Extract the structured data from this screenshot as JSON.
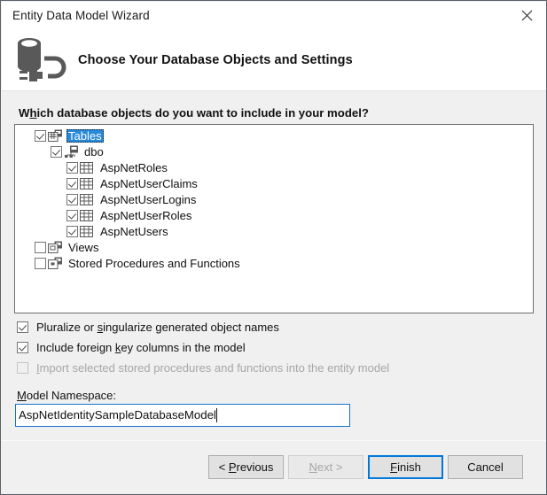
{
  "window": {
    "title": "Entity Data Model Wizard",
    "close_icon": "close-icon"
  },
  "header": {
    "icon": "database-connection-icon",
    "title": "Choose Your Database Objects and Settings"
  },
  "main": {
    "prompt_label_pre": "W",
    "prompt_label_accel": "h",
    "prompt_label_post": "ich database objects do you want to include in your model?",
    "prompt_label_full": "Which database objects do you want to include in your model?"
  },
  "tree": {
    "nodes": [
      {
        "label": "Tables",
        "level": 0,
        "checked": true,
        "selected": true,
        "icon": "tables-folder-icon"
      },
      {
        "label": "dbo",
        "level": 1,
        "checked": true,
        "selected": false,
        "icon": "schema-icon"
      },
      {
        "label": "AspNetRoles",
        "level": 2,
        "checked": true,
        "selected": false,
        "icon": "table-icon"
      },
      {
        "label": "AspNetUserClaims",
        "level": 2,
        "checked": true,
        "selected": false,
        "icon": "table-icon"
      },
      {
        "label": "AspNetUserLogins",
        "level": 2,
        "checked": true,
        "selected": false,
        "icon": "table-icon"
      },
      {
        "label": "AspNetUserRoles",
        "level": 2,
        "checked": true,
        "selected": false,
        "icon": "table-icon"
      },
      {
        "label": "AspNetUsers",
        "level": 2,
        "checked": true,
        "selected": false,
        "icon": "table-icon"
      },
      {
        "label": "Views",
        "level": 0,
        "checked": false,
        "selected": false,
        "icon": "views-folder-icon"
      },
      {
        "label": "Stored Procedures and Functions",
        "level": 0,
        "checked": false,
        "selected": false,
        "icon": "procedures-folder-icon"
      }
    ]
  },
  "options": [
    {
      "id": "pluralize",
      "pre": "Pluralize or ",
      "accel": "s",
      "post": "ingularize generated object names",
      "full": "Pluralize or singularize generated object names",
      "checked": true,
      "disabled": false
    },
    {
      "id": "foreign-keys",
      "pre": "Include foreign ",
      "accel": "k",
      "post": "ey columns in the model",
      "full": "Include foreign key columns in the model",
      "checked": true,
      "disabled": false
    },
    {
      "id": "import-procedures",
      "pre": "",
      "accel": "I",
      "post": "mport selected stored procedures and functions into the entity model",
      "full": "Import selected stored procedures and functions into the entity model",
      "checked": false,
      "disabled": true
    }
  ],
  "namespace": {
    "label_accel": "M",
    "label_post": "odel Namespace:",
    "label_full": "Model Namespace:",
    "value": "AspNetIdentitySampleDatabaseModel"
  },
  "buttons": [
    {
      "id": "previous",
      "pre": "< ",
      "accel": "P",
      "post": "revious",
      "full": "< Previous",
      "disabled": false,
      "default": false
    },
    {
      "id": "next",
      "pre": "",
      "accel": "N",
      "post": "ext >",
      "full": "Next >",
      "disabled": true,
      "default": false
    },
    {
      "id": "finish",
      "pre": "",
      "accel": "F",
      "post": "inish",
      "full": "Finish",
      "disabled": false,
      "default": true
    },
    {
      "id": "cancel",
      "pre": "",
      "accel": "",
      "post": "Cancel",
      "full": "Cancel",
      "disabled": false,
      "default": false
    }
  ],
  "colors": {
    "accent": "#0078d7",
    "selection": "#2889d8",
    "body_bg": "#f0f0f0",
    "panel_bg": "#ffffff",
    "icon_gray": "#5a5a5a"
  }
}
